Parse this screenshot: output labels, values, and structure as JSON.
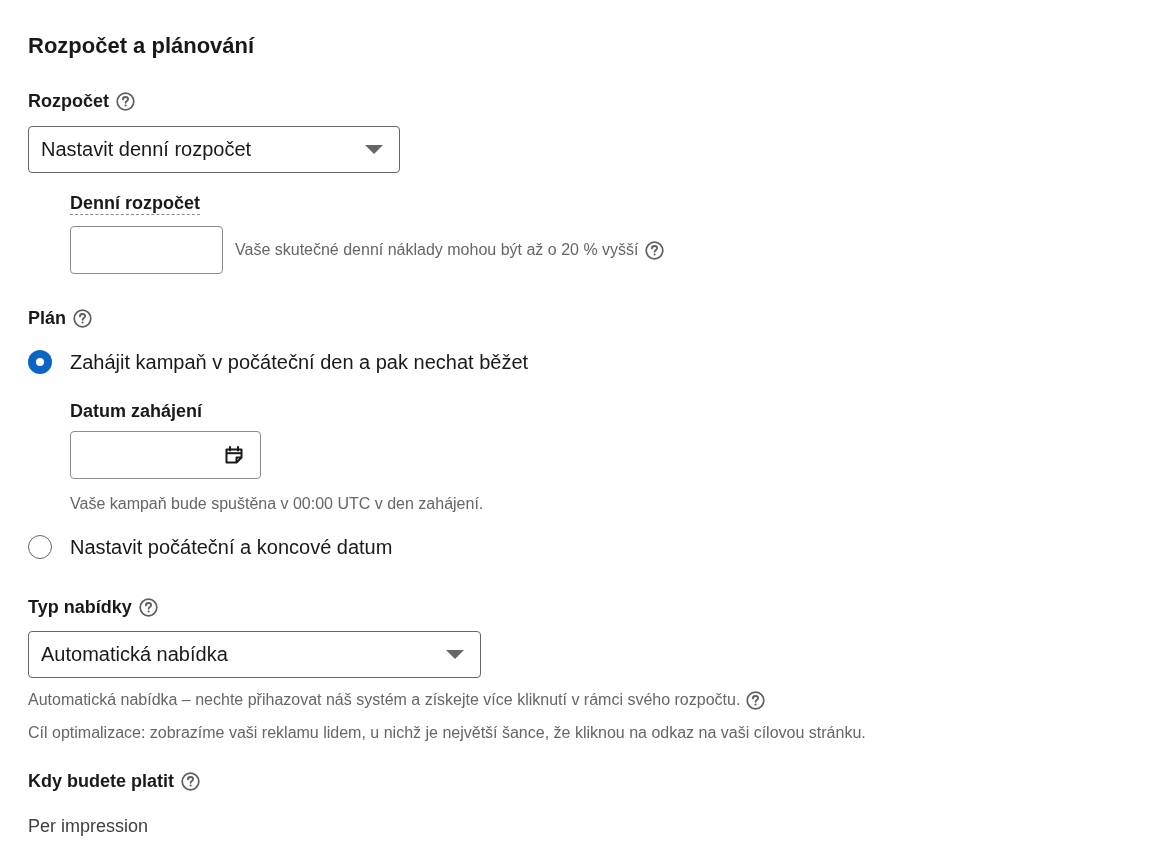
{
  "title": "Rozpočet a plánování",
  "budget": {
    "label": "Rozpočet",
    "dropdown_value": "Nastavit denní rozpočet",
    "daily_budget": {
      "label": "Denní rozpočet",
      "hint": {
        "text": "Vaše skutečné denní náklady mohou být až o 20 % vyšší",
        "help": true
      }
    }
  },
  "schedule": {
    "label": "Plán",
    "options": [
      {
        "label": "Zahájit kampaň v počáteční den a pak nechat běžet",
        "selected": true,
        "start_date": {
          "label": "Datum zahájení",
          "hint": "Vaše kampaň bude spuštěna v 00:00 UTC v den zahájení."
        }
      },
      {
        "label": "Nastavit počáteční a koncové datum",
        "selected": false
      }
    ]
  },
  "bid_type": {
    "label": "Typ nabídky",
    "dropdown_value": "Automatická nabídka",
    "hints": [
      {
        "text": "Automatická nabídka – nechte přihazovat náš systém a získejte více kliknutí v rámci svého rozpočtu.",
        "help": true
      },
      {
        "text": "Cíl optimalizace: zobrazíme vaši reklamu lidem, u nichž je největší šance, že kliknou na odkaz na vaši cílovou stránku.",
        "help": false
      }
    ]
  },
  "payment": {
    "label": "Kdy budete platit",
    "value": "Per impression"
  }
}
